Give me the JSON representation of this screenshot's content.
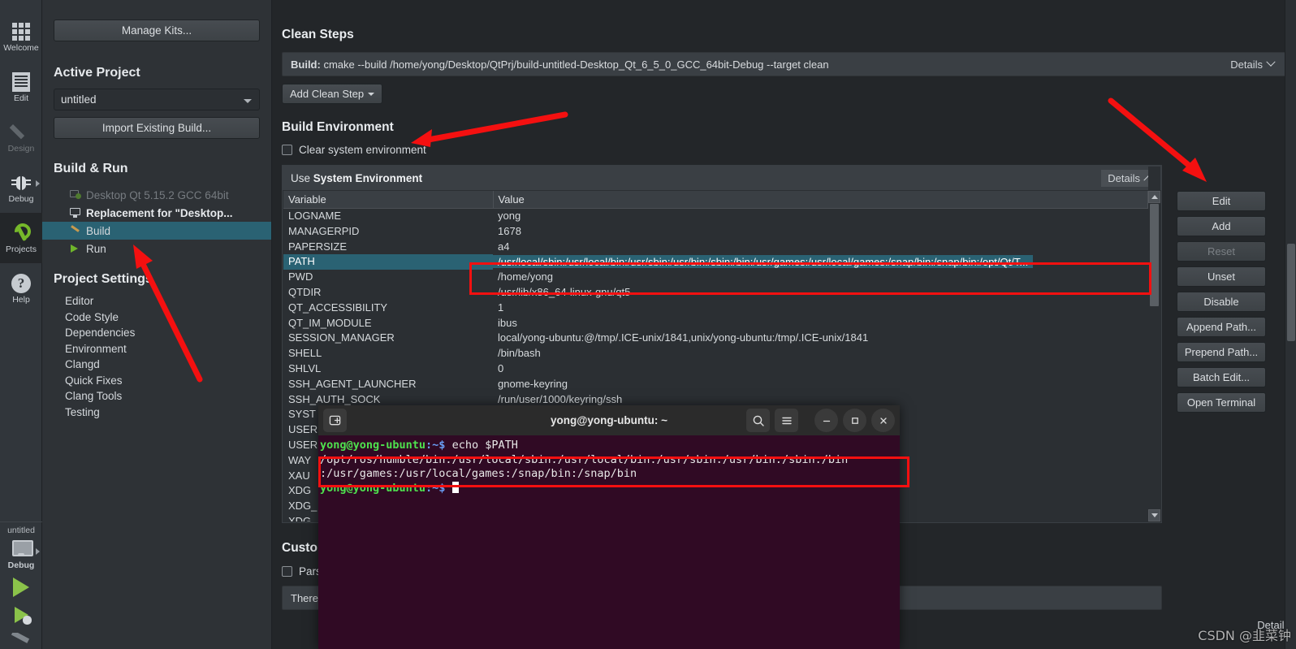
{
  "app": {
    "name": "Qt Creator",
    "mode": "Projects"
  },
  "modebar": {
    "items": [
      {
        "label": "Welcome",
        "icon": "grid-icon",
        "active": false,
        "dim": false,
        "arrow": false
      },
      {
        "label": "Edit",
        "icon": "document-icon",
        "active": false,
        "dim": false,
        "arrow": false
      },
      {
        "label": "Design",
        "icon": "pencil-icon",
        "active": false,
        "dim": true,
        "arrow": false
      },
      {
        "label": "Debug",
        "icon": "bug-icon",
        "active": false,
        "dim": false,
        "arrow": true
      },
      {
        "label": "Projects",
        "icon": "wrench-icon",
        "active": true,
        "dim": false,
        "arrow": false
      },
      {
        "label": "Help",
        "icon": "question-mark-icon",
        "active": false,
        "dim": false,
        "arrow": false
      }
    ],
    "kit_selector": {
      "project": "untitled",
      "build_config": "Debug",
      "icon": "monitor-icon"
    },
    "run_button": "run-icon",
    "debug_button": "run-debug-icon",
    "build_button": "build-hammer-icon"
  },
  "project_pane": {
    "manage_kits_label": "Manage Kits...",
    "active_project_title": "Active Project",
    "project_combo_value": "untitled",
    "import_build_label": "Import Existing Build...",
    "build_run_title": "Build & Run",
    "tree": [
      {
        "label": "Desktop Qt 5.15.2 GCC 64bit",
        "level": 1,
        "state": "dim",
        "icon": "kit-add-icon"
      },
      {
        "label": "Replacement for \"Desktop...",
        "level": 1,
        "state": "bold",
        "icon": "desktop-icon"
      },
      {
        "label": "Build",
        "level": 2,
        "state": "selected",
        "icon": "hammer-icon"
      },
      {
        "label": "Run",
        "level": 2,
        "state": "normal",
        "icon": "play-icon"
      }
    ],
    "project_settings_title": "Project Settings",
    "settings_items": [
      "Editor",
      "Code Style",
      "Dependencies",
      "Environment",
      "Clangd",
      "Quick Fixes",
      "Clang Tools",
      "Testing"
    ]
  },
  "main": {
    "clean_steps": {
      "title": "Clean Steps",
      "step_prefix": "Build:",
      "step_command": "cmake --build /home/yong/Desktop/QtPrj/build-untitled-Desktop_Qt_6_5_0_GCC_64bit-Debug --target clean",
      "details_label": "Details",
      "details_state": "collapsed",
      "add_step_label": "Add Clean Step"
    },
    "build_environment": {
      "title": "Build Environment",
      "clear_checkbox_label": "Clear system environment",
      "clear_checkbox_checked": false,
      "use_prefix": "Use",
      "use_value": "System Environment",
      "details_label": "Details",
      "details_state": "expanded",
      "columns": [
        "Variable",
        "Value"
      ],
      "rows": [
        {
          "variable": "LOGNAME",
          "value": "yong",
          "selected": false
        },
        {
          "variable": "MANAGERPID",
          "value": "1678",
          "selected": false
        },
        {
          "variable": "PAPERSIZE",
          "value": "a4",
          "selected": false
        },
        {
          "variable": "PATH",
          "value": "/usr/local/sbin:/usr/local/bin:/usr/sbin:/usr/bin:/sbin:/bin:/usr/games:/usr/local/games:/snap/bin:/snap/bin:/opt/Qt/T...",
          "selected": true
        },
        {
          "variable": "PWD",
          "value": "/home/yong",
          "selected": false
        },
        {
          "variable": "QTDIR",
          "value": "/usr/lib/x86_64-linux-gnu/qt5",
          "selected": false
        },
        {
          "variable": "QT_ACCESSIBILITY",
          "value": "1",
          "selected": false
        },
        {
          "variable": "QT_IM_MODULE",
          "value": "ibus",
          "selected": false
        },
        {
          "variable": "SESSION_MANAGER",
          "value": "local/yong-ubuntu:@/tmp/.ICE-unix/1841,unix/yong-ubuntu:/tmp/.ICE-unix/1841",
          "selected": false
        },
        {
          "variable": "SHELL",
          "value": "/bin/bash",
          "selected": false
        },
        {
          "variable": "SHLVL",
          "value": "0",
          "selected": false
        },
        {
          "variable": "SSH_AGENT_LAUNCHER",
          "value": "gnome-keyring",
          "selected": false
        },
        {
          "variable": "SSH_AUTH_SOCK",
          "value": "/run/user/1000/keyring/ssh",
          "selected": false
        },
        {
          "variable": "SYST",
          "value": "",
          "selected": false
        },
        {
          "variable": "USER",
          "value": "",
          "selected": false
        },
        {
          "variable": "USER",
          "value": "",
          "selected": false
        },
        {
          "variable": "WAY",
          "value": "",
          "selected": false
        },
        {
          "variable": "XAU",
          "value": "",
          "selected": false
        },
        {
          "variable": "XDG",
          "value": "",
          "selected": false
        },
        {
          "variable": "XDG_",
          "value": "",
          "selected": false
        },
        {
          "variable": "XDG",
          "value": "",
          "selected": false
        },
        {
          "variable": "XDG",
          "value": "",
          "selected": false
        }
      ],
      "buttons": [
        {
          "label": "Edit",
          "enabled": true
        },
        {
          "label": "Add",
          "enabled": true
        },
        {
          "label": "Reset",
          "enabled": false
        },
        {
          "label": "Unset",
          "enabled": true
        },
        {
          "label": "Disable",
          "enabled": true
        },
        {
          "label": "Append Path...",
          "enabled": true
        },
        {
          "label": "Prepend Path...",
          "enabled": true
        },
        {
          "label": "Batch Edit...",
          "enabled": true
        },
        {
          "label": "Open Terminal",
          "enabled": true
        }
      ]
    },
    "custom_section": {
      "title": "Custo",
      "checkbox_label": "Pars",
      "info_text": "There",
      "details_label": "Details"
    }
  },
  "terminal": {
    "title": "yong@yong-ubuntu: ~",
    "new_tab_icon": "new-tab-icon",
    "search_icon": "search-icon",
    "menu_icon": "hamburger-menu-icon",
    "minimize_icon": "minimize-icon",
    "maximize_icon": "maximize-icon",
    "close_icon": "close-icon",
    "lines": [
      {
        "prompt": "yong@yong-ubuntu",
        "path": ":~$",
        "command": " echo $PATH"
      },
      {
        "output": "/opt/ros/humble/bin:/usr/local/sbin:/usr/local/bin:/usr/sbin:/usr/bin:/sbin:/bin"
      },
      {
        "output": ":/usr/games:/usr/local/games:/snap/bin:/snap/bin"
      },
      {
        "prompt": "yong@yong-ubuntu",
        "path": ":~$",
        "command": ""
      }
    ]
  },
  "annotations": {
    "highlight_color": "#f41010",
    "arrows": 3,
    "boxes": 2,
    "watermark": "CSDN @韭菜钟"
  }
}
